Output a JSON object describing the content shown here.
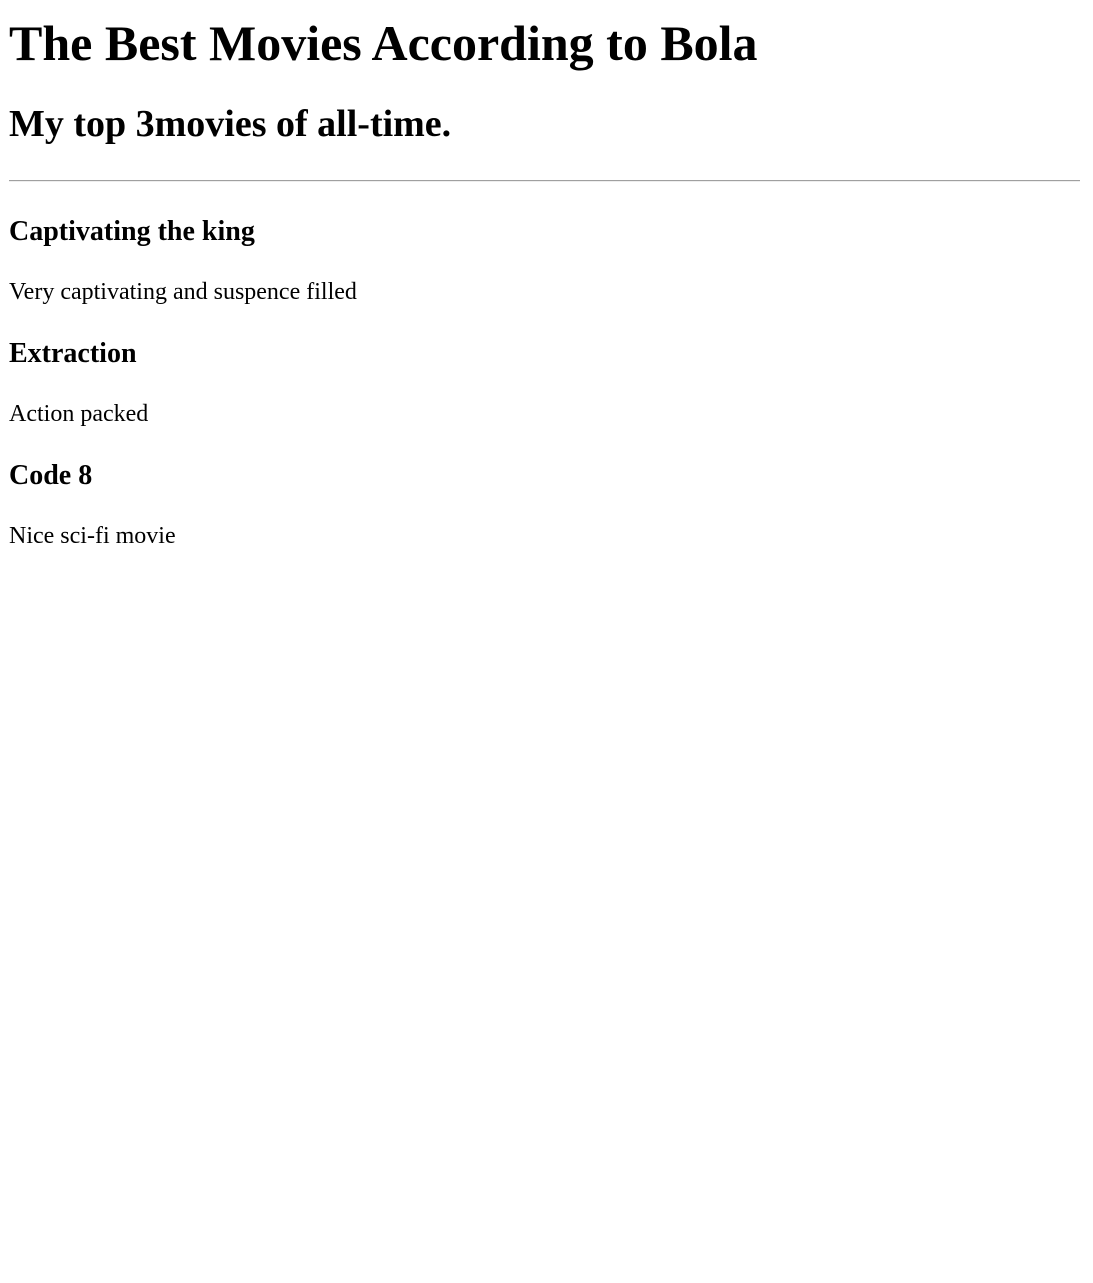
{
  "page": {
    "title": "The Best Movies According to Bola",
    "subtitle": "My top 3movies of all-time."
  },
  "movies": [
    {
      "name": "Captivating the king",
      "description": "Very captivating and suspence filled"
    },
    {
      "name": "Extraction",
      "description": "Action packed"
    },
    {
      "name": "Code 8",
      "description": "Nice sci-fi movie"
    }
  ]
}
